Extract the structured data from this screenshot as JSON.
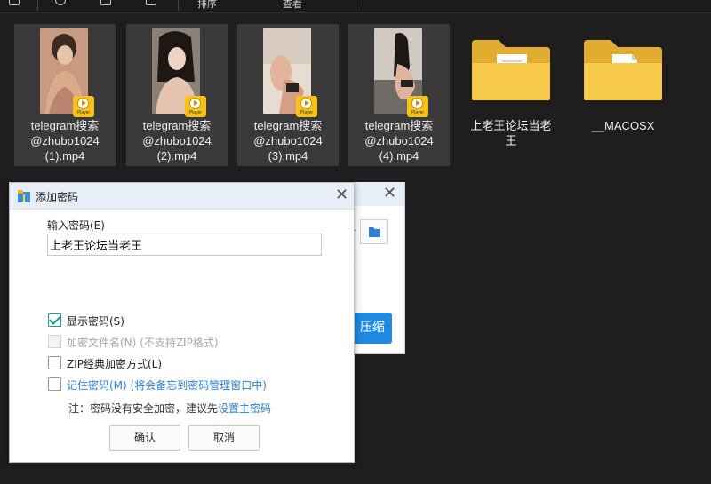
{
  "toolbar": {
    "sort_label": "排序",
    "view_label": "查看"
  },
  "files": [
    {
      "label": "telegram搜索\n@zhubo1024\n(1).mp4",
      "badge": "Player",
      "type": "video"
    },
    {
      "label": "telegram搜索\n@zhubo1024\n(2).mp4",
      "badge": "Player",
      "type": "video"
    },
    {
      "label": "telegram搜索\n@zhubo1024\n(3).mp4",
      "badge": "Player",
      "type": "video"
    },
    {
      "label": "telegram搜索\n@zhubo1024\n(4).mp4",
      "badge": "Player",
      "type": "video"
    },
    {
      "label": "上老王论坛当老\n王",
      "type": "folder"
    },
    {
      "label": "__MACOSX",
      "type": "folder"
    }
  ],
  "background_dialog": {
    "compress_label": "压缩"
  },
  "password_dialog": {
    "title": "添加密码",
    "close_glyph": "✕",
    "password_label": "输入密码(E)",
    "password_value": "上老王论坛当老王",
    "options": {
      "show_password": {
        "label": "显示密码(S)",
        "checked": true
      },
      "encrypt_filenames": {
        "label": "加密文件名(N) (不支持ZIP格式)",
        "checked": false,
        "disabled": true
      },
      "zip_classic": {
        "label": "ZIP经典加密方式(L)",
        "checked": false
      },
      "remember_password": {
        "label": "记住密码(M) (将会备忘到密码管理窗口中)",
        "checked": false
      }
    },
    "note_prefix": "注：密码没有安全加密，建议先",
    "note_link": "设置主密码",
    "ok_label": "确认",
    "cancel_label": "取消"
  },
  "colors": {
    "background": "#1e1e1e",
    "tile": "#3a3a3a",
    "folder": "#f7c948",
    "accent": "#1e88e5",
    "check": "#16a37f",
    "link": "#2e7fd6"
  }
}
